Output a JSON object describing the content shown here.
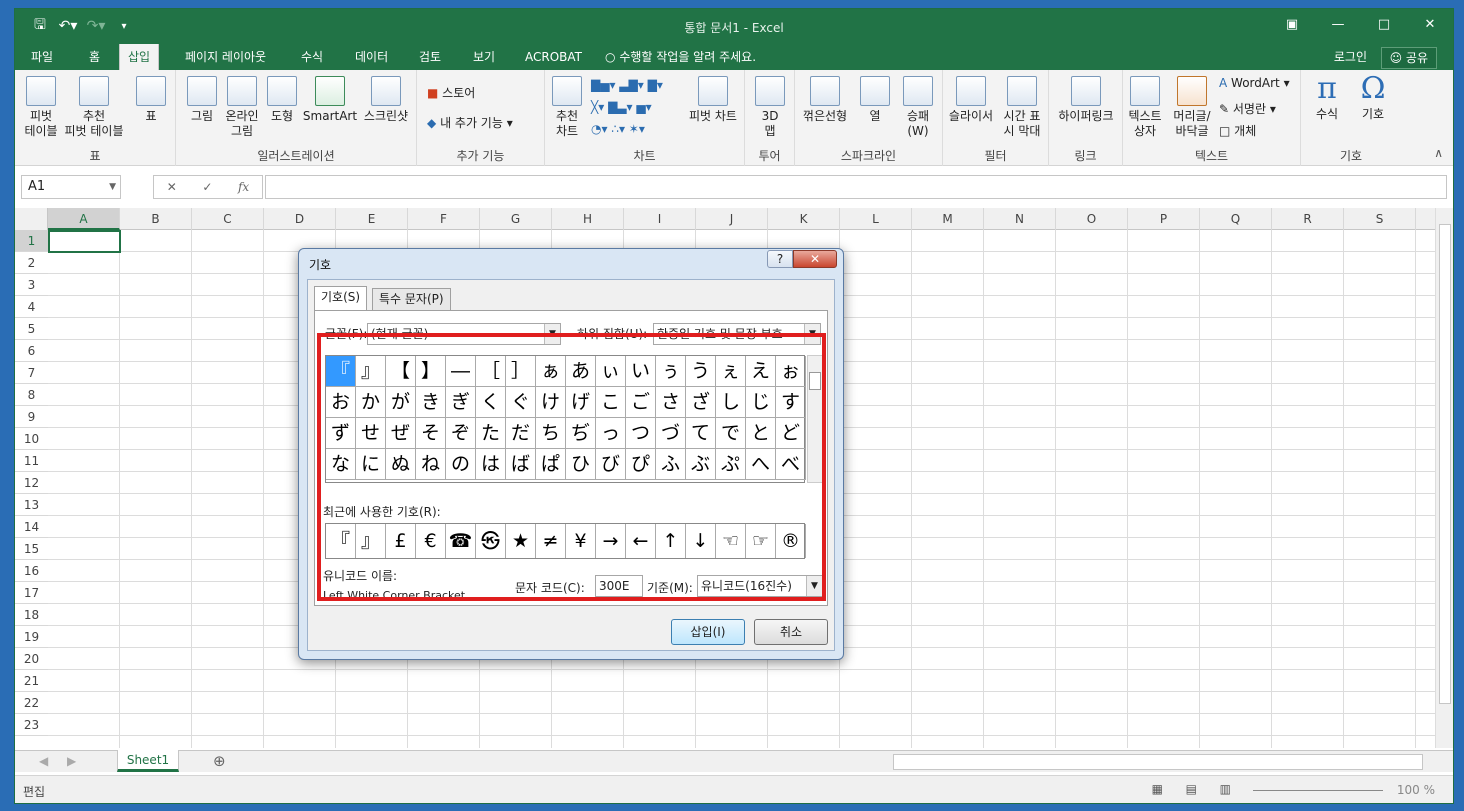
{
  "app": {
    "title": "통합 문서1 - Excel"
  },
  "tabs": [
    "파일",
    "홈",
    "삽입",
    "페이지 레이아웃",
    "수식",
    "데이터",
    "검토",
    "보기",
    "ACROBAT"
  ],
  "tell_me": "수행할 작업을 알려 주세요.",
  "account": {
    "login": "로그인",
    "share": "공유"
  },
  "ribbon": {
    "pivot": "피벗\n테이블",
    "rec_pivot": "추천\n피벗 테이블",
    "table": "표",
    "g_table": "표",
    "picture": "그림",
    "online_picture": "온라인\n그림",
    "shapes": "도형",
    "smartart": "SmartArt",
    "screenshot": "스크린샷",
    "g_illus": "일러스트레이션",
    "store": "스토어",
    "my_addins": "내 추가 기능",
    "g_addins": "추가 기능",
    "rec_chart": "추천\n차트",
    "pivot_chart": "피벗 차트",
    "g_charts": "차트",
    "map3d": "3D\n맵",
    "g_tour": "투어",
    "line": "꺾은선형",
    "column": "열",
    "winloss": "승패\n(W)",
    "g_spark": "스파크라인",
    "slicer": "슬라이서",
    "timeline": "시간 표\n시 막대",
    "g_filter": "필터",
    "hyperlink": "하이퍼링크",
    "g_link": "링크",
    "textbox": "텍스트\n상자",
    "headerfooter": "머리글/\n바닥글",
    "wordart": "WordArt",
    "signature": "서명란",
    "object": "개체",
    "g_text": "텍스트",
    "equation": "수식",
    "symbol": "기호",
    "g_symbols": "기호"
  },
  "namebox": "A1",
  "columns": [
    "A",
    "B",
    "C",
    "D",
    "E",
    "F",
    "G",
    "H",
    "I",
    "J",
    "K",
    "L",
    "M",
    "N",
    "O",
    "P",
    "Q",
    "R",
    "S"
  ],
  "rows": [
    "1",
    "2",
    "3",
    "4",
    "5",
    "6",
    "7",
    "8",
    "9",
    "10",
    "11",
    "12",
    "13",
    "14",
    "15",
    "16",
    "17",
    "18",
    "19",
    "20",
    "21",
    "22",
    "23"
  ],
  "sheet": {
    "tab": "Sheet1"
  },
  "status": {
    "mode": "편집",
    "zoom": "100 %"
  },
  "dialog": {
    "title": "기호",
    "help": "?",
    "tab_symbols": "기호(S)",
    "tab_special": "특수 문자(P)",
    "font_label": "글꼴(F):",
    "font_value": "(현재 글꼴)",
    "subset_label": "하위 집합(U):",
    "subset_value": "한중일 기호 및 문장 부호",
    "symbols": [
      "『",
      "』",
      "【",
      "】",
      "―",
      "［",
      "］",
      "ぁ",
      "あ",
      "ぃ",
      "い",
      "ぅ",
      "う",
      "ぇ",
      "え",
      "ぉ",
      "お",
      "か",
      "が",
      "き",
      "ぎ",
      "く",
      "ぐ",
      "け",
      "げ",
      "こ",
      "ご",
      "さ",
      "ざ",
      "し",
      "じ",
      "す",
      "ず",
      "せ",
      "ぜ",
      "そ",
      "ぞ",
      "た",
      "だ",
      "ち",
      "ぢ",
      "っ",
      "つ",
      "づ",
      "て",
      "で",
      "と",
      "ど",
      "な",
      "に",
      "ぬ",
      "ね",
      "の",
      "は",
      "ば",
      "ぱ",
      "ひ",
      "び",
      "ぴ",
      "ふ",
      "ぶ",
      "ぷ",
      "へ",
      "べ"
    ],
    "recent_label": "최근에 사용한 기호(R):",
    "recent": [
      "『",
      "』",
      "£",
      "€",
      "☎",
      "㉿",
      "★",
      "≠",
      "¥",
      "→",
      "←",
      "↑",
      "↓",
      "☜",
      "☞",
      "®"
    ],
    "unicode_name_label": "유니코드 이름:",
    "unicode_name": "Left White Corner Bracket",
    "charcode_label": "문자 코드(C):",
    "charcode": "300E",
    "from_label": "기준(M):",
    "from_value": "유니코드(16진수)",
    "insert": "삽입(I)",
    "cancel": "취소"
  }
}
